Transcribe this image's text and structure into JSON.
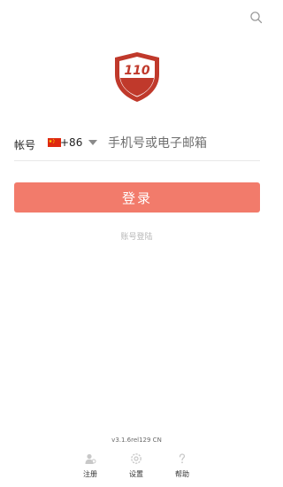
{
  "header": {
    "search_icon": "search-icon"
  },
  "logo": {
    "text": "110",
    "colors": {
      "shield": "#c0392b",
      "band": "#c0392b",
      "background": "#ffffff"
    }
  },
  "login_form": {
    "account_label": "帐号",
    "country": {
      "flag": "china-flag",
      "code": "+86"
    },
    "phone_placeholder": "手机号或电子邮箱",
    "phone_value": "",
    "login_button": "登录",
    "alt_login_link": "账号登陆"
  },
  "footer": {
    "version": "v3.1.6rel129 CN",
    "nav": [
      {
        "label": "注册",
        "icon": "user-icon"
      },
      {
        "label": "设置",
        "icon": "gear-icon"
      },
      {
        "label": "帮助",
        "icon": "help-icon"
      }
    ]
  },
  "colors": {
    "accent": "#f27b6b",
    "brand": "#c0392b",
    "muted_text": "#b7b7b7",
    "divider": "#e8e8e8"
  }
}
